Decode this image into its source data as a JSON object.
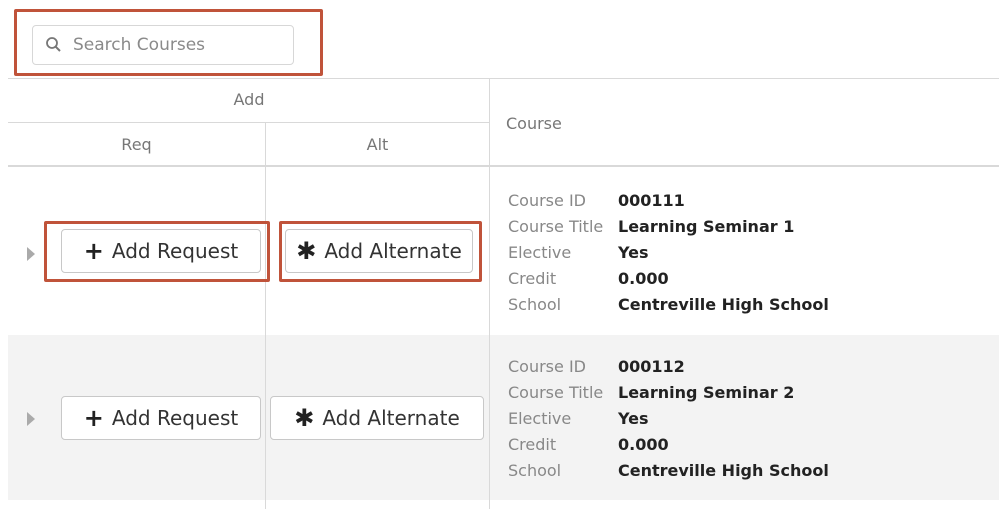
{
  "search": {
    "placeholder": "Search Courses",
    "value": ""
  },
  "table": {
    "group_header": "Add",
    "columns": {
      "req": "Req",
      "alt": "Alt",
      "course": "Course"
    }
  },
  "rows": [
    {
      "add_request_label": "Add Request",
      "add_alternate_label": "Add Alternate",
      "fields": [
        {
          "label": "Course ID",
          "value": "000111"
        },
        {
          "label": "Course Title",
          "value": "Learning Seminar 1"
        },
        {
          "label": "Elective",
          "value": "Yes"
        },
        {
          "label": "Credit",
          "value": "0.000"
        },
        {
          "label": "School",
          "value": "Centreville High School"
        }
      ]
    },
    {
      "add_request_label": "Add Request",
      "add_alternate_label": "Add Alternate",
      "fields": [
        {
          "label": "Course ID",
          "value": "000112"
        },
        {
          "label": "Course Title",
          "value": "Learning Seminar 2"
        },
        {
          "label": "Elective",
          "value": "Yes"
        },
        {
          "label": "Credit",
          "value": "0.000"
        },
        {
          "label": "School",
          "value": "Centreville High School"
        }
      ]
    }
  ],
  "icons": {
    "search": "search-icon",
    "plus": "plus-icon",
    "asterisk": "asterisk-icon",
    "expand": "caret-right-icon"
  },
  "colors": {
    "highlight": "#c0533a",
    "alt_row": "#f3f3f3"
  }
}
